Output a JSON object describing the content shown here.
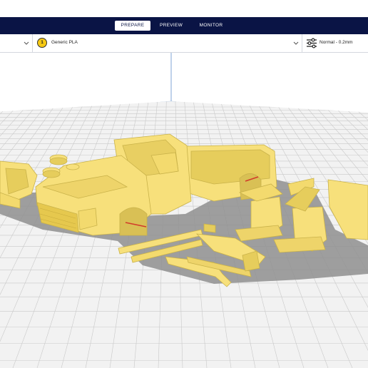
{
  "header": {
    "stages": [
      {
        "label": "PREPARE",
        "active": true
      },
      {
        "label": "PREVIEW",
        "active": false
      },
      {
        "label": "MONITOR",
        "active": false
      }
    ]
  },
  "toolbar": {
    "material": {
      "extruder_number": "1",
      "name": "Generic PLA"
    },
    "print_profile": "Normal - 0.2mm"
  },
  "colors": {
    "stage_bar": "#0a1445",
    "model_yellow": "#f7e07b",
    "build_plate_grid": "#c9c9c9",
    "model_shadow": "#8f8f8f"
  },
  "icons": {
    "printer_dropdown": "chevron-down-icon",
    "material_dropdown": "chevron-down-icon",
    "print_settings": "sliders-icon"
  }
}
